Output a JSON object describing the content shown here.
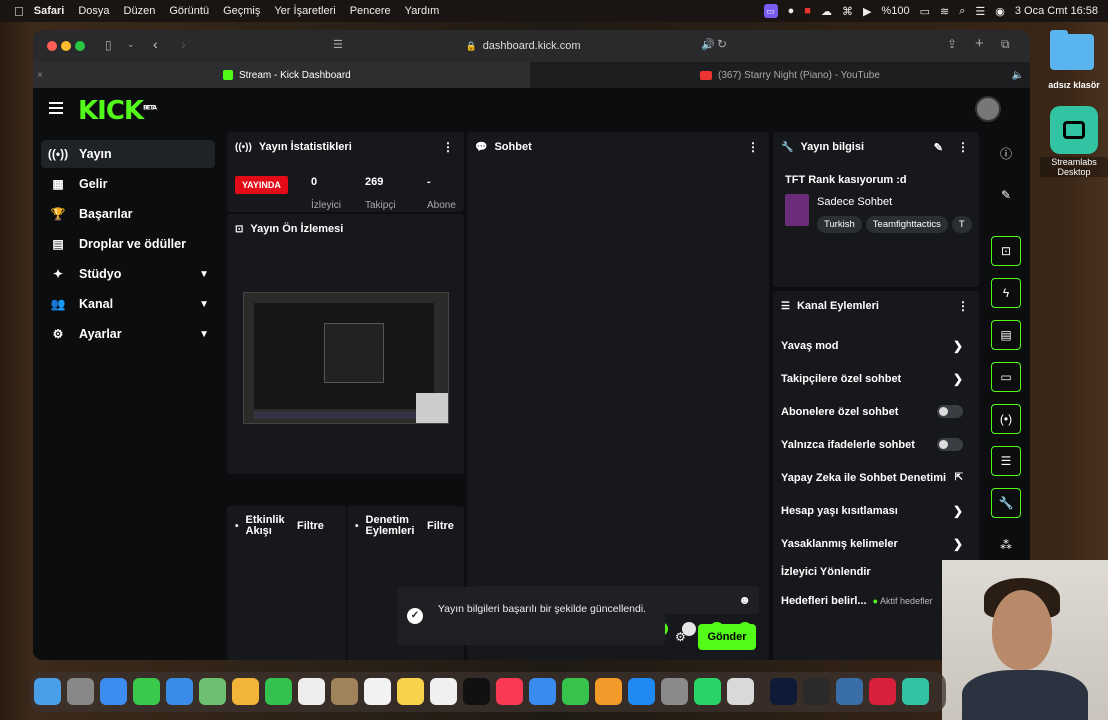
{
  "menubar": {
    "items": [
      "Safari",
      "Dosya",
      "Düzen",
      "Görüntü",
      "Geçmiş",
      "Yer İşaretleri",
      "Pencere",
      "Yardım"
    ],
    "battery": "%100",
    "datetime": "3 Oca Cmt  16:58"
  },
  "desktop": {
    "folder_label": "adsız klasör",
    "streamlabs_label": "Streamlabs Desktop"
  },
  "browser": {
    "url": "dashboard.kick.com",
    "tabs": [
      {
        "label": "Stream - Kick Dashboard",
        "active": true
      },
      {
        "label": "(367) Starry Night (Piano) - YouTube",
        "active": false
      }
    ]
  },
  "kick": {
    "logo": "KICK",
    "beta": "BETA",
    "sidebar": [
      {
        "label": "Yayın",
        "icon": "broadcast-icon",
        "active": true
      },
      {
        "label": "Gelir",
        "icon": "chart-icon"
      },
      {
        "label": "Başarılar",
        "icon": "trophy-icon"
      },
      {
        "label": "Droplar ve ödüller",
        "icon": "gift-icon"
      },
      {
        "label": "Stüdyo",
        "icon": "studio-icon",
        "expandable": true
      },
      {
        "label": "Kanal",
        "icon": "users-icon",
        "expandable": true
      },
      {
        "label": "Ayarlar",
        "icon": "gear-icon",
        "expandable": true
      }
    ],
    "stats_panel": {
      "title": "Yayın İstatistikleri",
      "live_badge": "YAYINDA",
      "viewers": "0",
      "viewers_label": "İzleyici",
      "followers": "269",
      "followers_label": "Takipçi",
      "subs": "-",
      "subs_label": "Abone"
    },
    "preview_panel": {
      "title": "Yayın Ön İzlemesi"
    },
    "activity_panel": {
      "title": "Etkinlik Akışı",
      "filter": "Filtre"
    },
    "moderation_panel": {
      "title": "Denetim Eylemleri",
      "filter": "Filtre"
    },
    "chat_panel": {
      "title": "Sohbet",
      "send": "Gönder"
    },
    "info_panel": {
      "title": "Yayın bilgisi",
      "stream_title": "TFT Rank kasıyorum :d",
      "category": "Sadece Sohbet",
      "tags": [
        "Turkish",
        "Teamfighttactics",
        "T"
      ]
    },
    "actions_panel": {
      "title": "Kanal Eylemleri",
      "items": [
        {
          "label": "Yavaş mod",
          "control": "arrow"
        },
        {
          "label": "Takipçilere özel sohbet",
          "control": "arrow"
        },
        {
          "label": "Abonelere özel sohbet",
          "control": "toggle",
          "on": false
        },
        {
          "label": "Yalnızca ifadelerle sohbet",
          "control": "toggle",
          "on": false
        },
        {
          "label": "Yapay Zeka ile Sohbet Denetimi",
          "control": "external"
        },
        {
          "label": "Hesap yaşı kısıtlaması",
          "control": "arrow"
        },
        {
          "label": "Yasaklanmış kelimeler",
          "control": "arrow"
        },
        {
          "label": "İzleyici Yönlendir",
          "control": "none"
        },
        {
          "label": "Hedefleri belirl...",
          "control": "badge"
        }
      ],
      "goal_badge": "Aktif hedefler"
    },
    "toast": {
      "message": "Yayın bilgileri başarılı bir şekilde güncellendi."
    }
  },
  "colors": {
    "kick_green": "#53fc18",
    "live_red": "#e30b17",
    "panel": "#16181b",
    "page": "#0b0d0f"
  }
}
